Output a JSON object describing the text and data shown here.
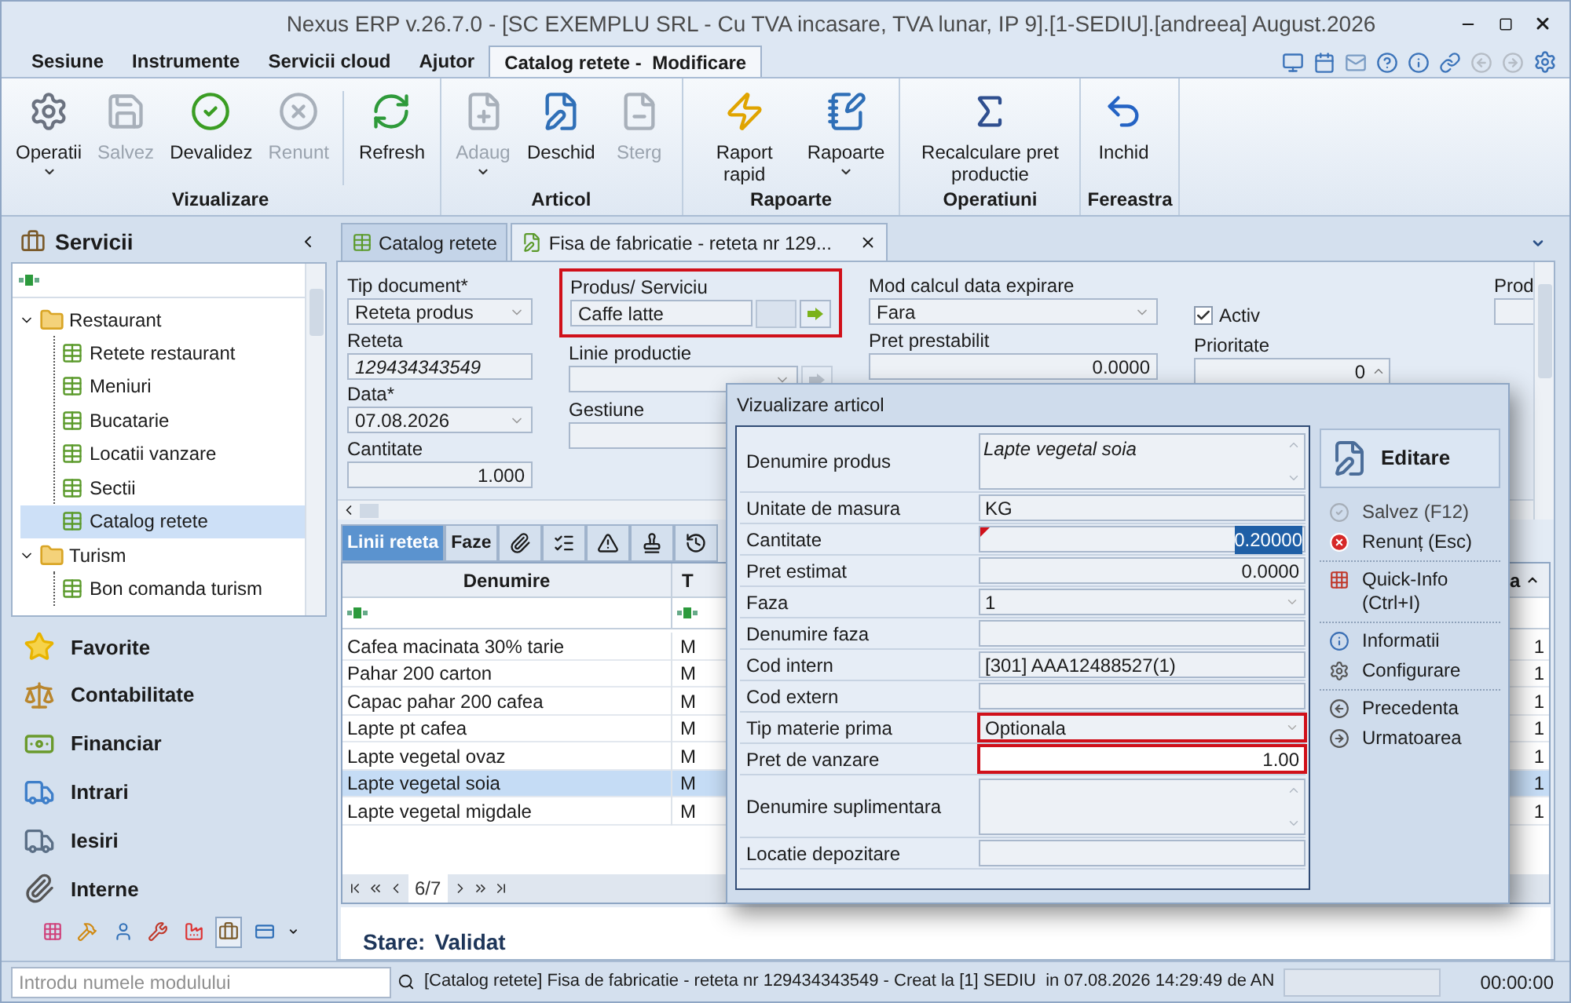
{
  "window": {
    "title": "Nexus ERP v.26.7.0 - [SC EXEMPLU SRL - Cu TVA incasare, TVA lunar, IP 9].[1-SEDIU].[andreea] August.2026"
  },
  "menu_tabs": [
    {
      "label": "Sesiune",
      "selected": false
    },
    {
      "label": "Instrumente",
      "selected": false
    },
    {
      "label": "Servicii cloud",
      "selected": false
    },
    {
      "label": "Ajutor",
      "selected": false
    },
    {
      "label": "Catalog retete -  Modificare",
      "selected": true
    }
  ],
  "ribbon": {
    "groups": [
      {
        "label": "Vizualizare",
        "buttons": [
          {
            "label": "Operatii",
            "disabled": false,
            "dropdown": true
          },
          {
            "label": "Salvez",
            "disabled": true
          },
          {
            "label": "Devalidez",
            "disabled": false
          },
          {
            "label": "Renunt",
            "disabled": true
          },
          {
            "label": "Refresh",
            "disabled": false,
            "separator_before": true
          }
        ]
      },
      {
        "label": "Articol",
        "buttons": [
          {
            "label": "Adaug",
            "disabled": true,
            "dropdown": true
          },
          {
            "label": "Deschid",
            "disabled": false
          },
          {
            "label": "Sterg",
            "disabled": true
          }
        ]
      },
      {
        "label": "Rapoarte",
        "buttons": [
          {
            "label": "Raport rapid",
            "disabled": false
          },
          {
            "label": "Rapoarte",
            "disabled": false,
            "dropdown": true
          }
        ]
      },
      {
        "label": "Operatiuni",
        "buttons": [
          {
            "label": "Recalculare pret productie",
            "disabled": false
          }
        ]
      },
      {
        "label": "Fereastra",
        "buttons": [
          {
            "label": "Inchid",
            "disabled": false
          }
        ]
      }
    ]
  },
  "sidebar": {
    "title": "Servicii",
    "tree": [
      {
        "label": "Restaurant",
        "expanded": true,
        "selected": false,
        "children": [
          {
            "label": "Retete restaurant",
            "selected": false
          },
          {
            "label": "Meniuri",
            "selected": false
          },
          {
            "label": "Bucatarie",
            "selected": false
          },
          {
            "label": "Locatii vanzare",
            "selected": false
          },
          {
            "label": "Sectii",
            "selected": false
          },
          {
            "label": "Catalog retete",
            "selected": true
          }
        ]
      },
      {
        "label": "Turism",
        "expanded": true,
        "selected": false,
        "children": [
          {
            "label": "Bon comanda turism",
            "selected": false
          }
        ]
      }
    ],
    "modules": [
      {
        "label": "Favorite"
      },
      {
        "label": "Contabilitate"
      },
      {
        "label": "Financiar"
      },
      {
        "label": "Intrari"
      },
      {
        "label": "Iesiri"
      },
      {
        "label": "Interne"
      }
    ],
    "module_bar": [
      {
        "selected": false
      },
      {
        "selected": false
      },
      {
        "selected": false
      },
      {
        "selected": false
      },
      {
        "selected": false
      },
      {
        "selected": true
      },
      {
        "selected": false
      }
    ],
    "search": {
      "placeholder": "Introdu numele modulului"
    }
  },
  "doc_tabs": [
    {
      "label": "Catalog retete",
      "selected": false,
      "closable": false
    },
    {
      "label": "Fisa de fabricatie - reteta nr 129...",
      "selected": true,
      "closable": true
    }
  ],
  "form": {
    "columns": [
      [
        {
          "label": "Tip document*",
          "kind": "select",
          "value": "Reteta produs"
        },
        {
          "label": "Reteta",
          "kind": "text",
          "value": "129434343549",
          "italic": true
        },
        {
          "label": "Data*",
          "kind": "select",
          "value": "07.08.2026"
        },
        {
          "label": "Cantitate",
          "kind": "number",
          "value": "1.000"
        }
      ],
      [
        {
          "label": "Produs/ Serviciu",
          "kind": "lookup",
          "value": "Caffe latte",
          "highlighted": true
        },
        {
          "label": "Linie productie",
          "kind": "lookup-select"
        },
        {
          "label": "Gestiune",
          "kind": "text"
        }
      ],
      [
        {
          "label": "Mod calcul data expirare",
          "kind": "select",
          "value": "Fara"
        },
        {
          "label": "Pret prestabilit",
          "kind": "number",
          "value": "0.0000"
        }
      ],
      [
        {
          "label": "Activ",
          "kind": "checkbox",
          "checked": true
        },
        {
          "label": "Prioritate",
          "kind": "spin",
          "value": "0"
        }
      ],
      [
        {
          "label": "Prod",
          "kind": "text"
        }
      ]
    ]
  },
  "detail_tabs": [
    {
      "kind": "text",
      "label": "Linii reteta",
      "selected": true
    },
    {
      "kind": "text",
      "label": "Faze",
      "selected": false
    },
    {
      "kind": "icon",
      "selected": false
    },
    {
      "kind": "icon",
      "selected": false
    },
    {
      "kind": "icon",
      "selected": false
    },
    {
      "kind": "icon",
      "selected": false
    },
    {
      "kind": "icon",
      "selected": false
    }
  ],
  "grid": {
    "columns": [
      "Denumire",
      "T",
      "a"
    ],
    "rows": [
      {
        "name": "Cafea macinata 30% tarie",
        "column_2": "M",
        "column_3": "1",
        "selected": false
      },
      {
        "name": "Pahar 200 carton",
        "column_2": "M",
        "column_3": "1",
        "selected": false
      },
      {
        "name": "Capac pahar 200 cafea",
        "column_2": "M",
        "column_3": "1",
        "selected": false
      },
      {
        "name": "Lapte pt cafea",
        "column_2": "M",
        "column_3": "1",
        "selected": false
      },
      {
        "name": "Lapte vegetal ovaz",
        "column_2": "M",
        "column_3": "1",
        "selected": false
      },
      {
        "name": "Lapte vegetal soia",
        "column_2": "M",
        "column_3": "1",
        "selected": true
      },
      {
        "name": "Lapte vegetal migdale",
        "column_2": "M",
        "column_3": "1",
        "selected": false
      }
    ],
    "pager": "6/7"
  },
  "state": {
    "label": "Stare:",
    "value": "Validat"
  },
  "dialog": {
    "title": "Vizualizare articol",
    "fields": [
      {
        "label": "Denumire produs",
        "kind": "memo",
        "value": "Lapte vegetal soia"
      },
      {
        "label": "Unitate de masura",
        "kind": "text",
        "value": "KG"
      },
      {
        "label": "Cantitate",
        "kind": "number",
        "value": "0.20000",
        "text_selected": true,
        "modified": true
      },
      {
        "label": "Pret estimat",
        "kind": "number",
        "value": "0.0000"
      },
      {
        "label": "Faza",
        "kind": "select",
        "value": "1"
      },
      {
        "label": "Denumire faza",
        "kind": "text"
      },
      {
        "label": "Cod intern",
        "kind": "text",
        "value": "[301] AAA12488527(1)"
      },
      {
        "label": "Cod extern",
        "kind": "text"
      },
      {
        "label": "Tip materie prima",
        "kind": "select",
        "value": "Optionala",
        "highlighted": true
      },
      {
        "label": "Pret de vanzare",
        "kind": "number",
        "value": "1.00",
        "highlighted": true
      },
      {
        "label": "Denumire suplimentara",
        "kind": "memo"
      },
      {
        "label": "Locatie depozitare",
        "kind": "text"
      }
    ],
    "header_action": "Editare",
    "actions": [
      {
        "label": "Salvez (F12)",
        "disabled": true
      },
      {
        "label": "Renunț (Esc)",
        "disabled": false
      },
      {
        "label": "Quick-Info (Ctrl+I)",
        "disabled": false,
        "separator_before": true
      },
      {
        "label": "Informatii",
        "disabled": false,
        "separator_before": true
      },
      {
        "label": "Configurare",
        "disabled": false
      },
      {
        "label": "Precedenta",
        "disabled": false,
        "separator_before": true
      },
      {
        "label": "Urmatoarea",
        "disabled": false
      }
    ]
  },
  "status_bar": {
    "message": "[Catalog retete] Fisa de fabricatie - reteta nr 129434343549 - Creat la [1] SEDIU  in 07.08.2026 14:29:49 de AN",
    "time": "00:00:00"
  }
}
